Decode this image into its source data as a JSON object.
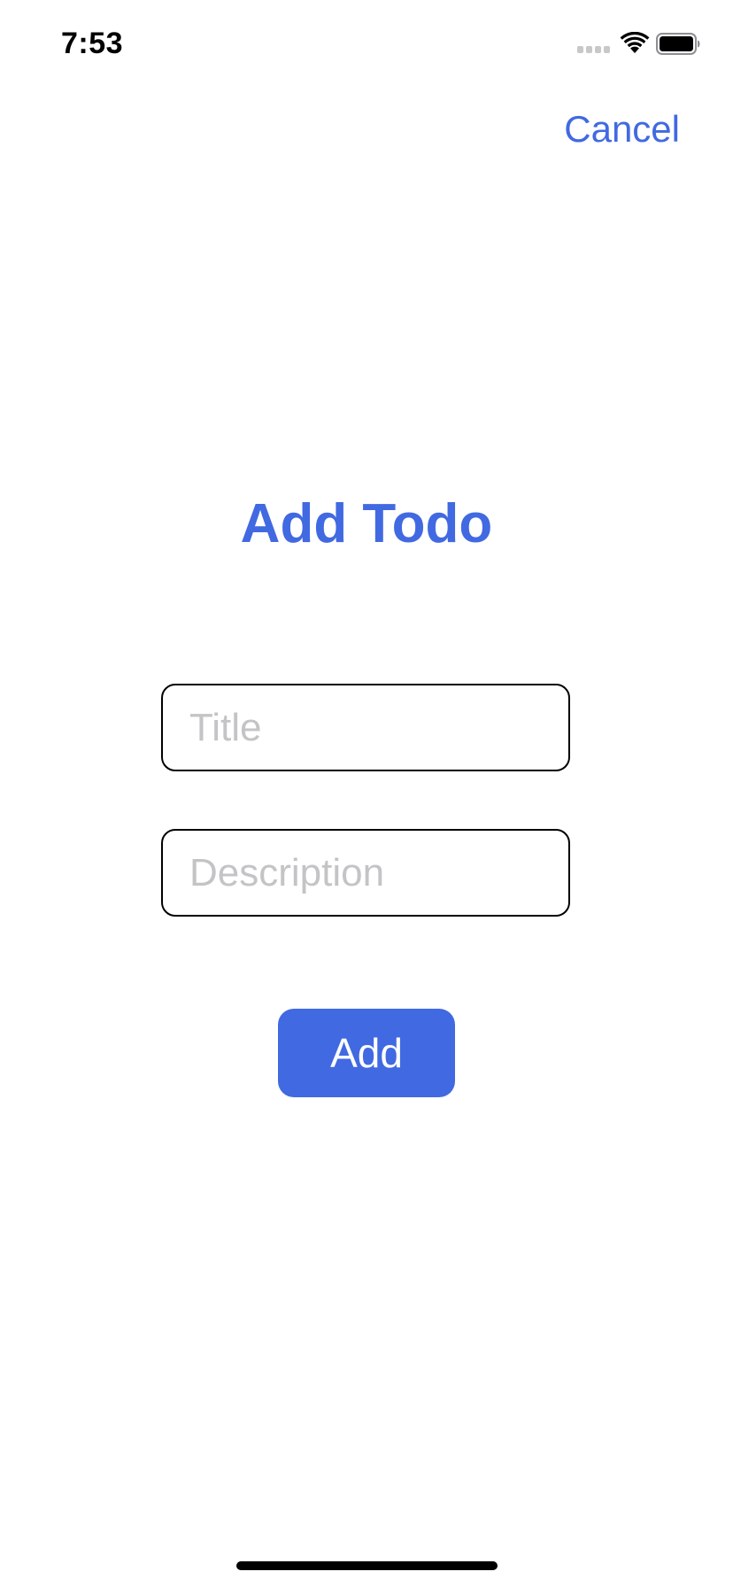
{
  "status_bar": {
    "time": "7:53"
  },
  "nav": {
    "cancel_label": "Cancel"
  },
  "form": {
    "title": "Add Todo",
    "title_field": {
      "value": "",
      "placeholder": "Title"
    },
    "description_field": {
      "value": "",
      "placeholder": "Description"
    },
    "add_label": "Add"
  },
  "colors": {
    "accent": "#4169e1",
    "placeholder": "#c4c4c6",
    "field_border": "#000000",
    "background": "#ffffff"
  },
  "icons": {
    "signal": "cellular-signal-icon",
    "wifi": "wifi-icon",
    "battery": "battery-icon"
  }
}
